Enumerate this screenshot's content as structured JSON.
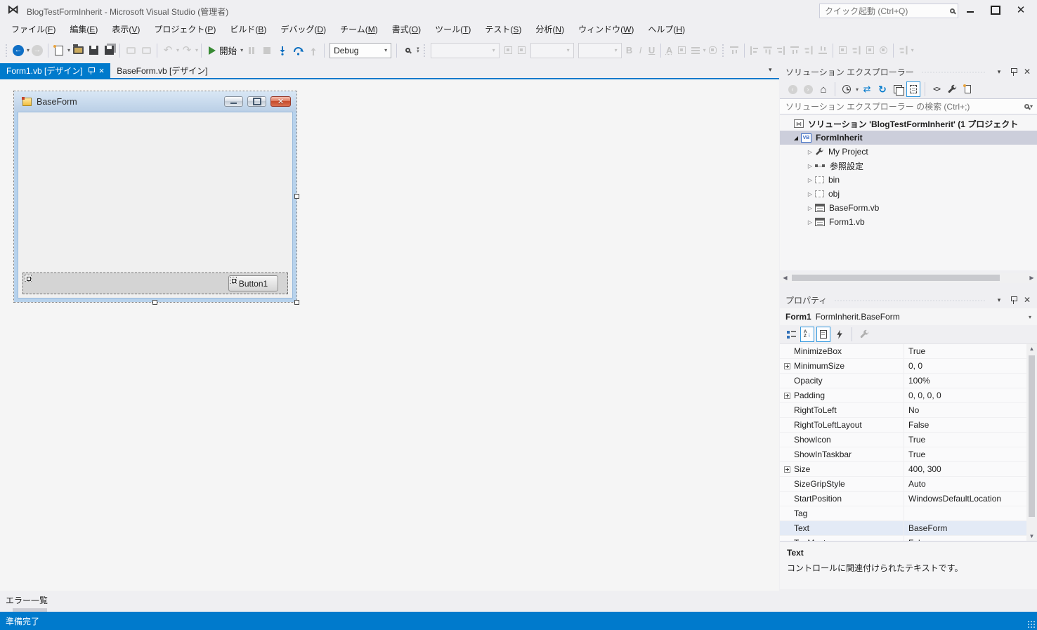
{
  "title_bar": {
    "app_title": "BlogTestFormInherit - Microsoft Visual Studio (管理者)",
    "quick_launch_placeholder": "クイック起動 (Ctrl+Q)"
  },
  "menu_bar": {
    "items": [
      {
        "label": "ファイル(F)"
      },
      {
        "label": "編集(E)"
      },
      {
        "label": "表示(V)"
      },
      {
        "label": "プロジェクト(P)"
      },
      {
        "label": "ビルド(B)"
      },
      {
        "label": "デバッグ(D)"
      },
      {
        "label": "チーム(M)"
      },
      {
        "label": "書式(O)"
      },
      {
        "label": "ツール(T)"
      },
      {
        "label": "テスト(S)"
      },
      {
        "label": "分析(N)"
      },
      {
        "label": "ウィンドウ(W)"
      },
      {
        "label": "ヘルプ(H)"
      }
    ]
  },
  "toolbar": {
    "start_label": "開始",
    "debug_combo_value": "Debug",
    "bold_label": "B",
    "italic_label": "I",
    "underline_label": "U"
  },
  "editor": {
    "tabs": [
      {
        "label": "Form1.vb [デザイン]",
        "active": true
      },
      {
        "label": "BaseForm.vb [デザイン]",
        "active": false
      }
    ]
  },
  "designer": {
    "form_title": "BaseForm",
    "button_label": "Button1"
  },
  "solution_explorer": {
    "title": "ソリューション エクスプローラー",
    "search_placeholder": "ソリューション エクスプローラー の検索 (Ctrl+;)",
    "tree": [
      {
        "label": "ソリューション 'BlogTestFormInherit' (1 プロジェクト",
        "icon": "solution",
        "arrow": "none",
        "level": 0,
        "selected": false,
        "bold": true
      },
      {
        "label": "FormInherit",
        "icon": "vb-project",
        "arrow": "expanded",
        "level": 1,
        "selected": true,
        "bold": true
      },
      {
        "label": "My Project",
        "icon": "wrench",
        "arrow": "collapsed",
        "level": 2,
        "selected": false,
        "bold": false
      },
      {
        "label": "参照設定",
        "icon": "references",
        "arrow": "collapsed",
        "level": 2,
        "selected": false,
        "bold": false
      },
      {
        "label": "bin",
        "icon": "folder-dashed",
        "arrow": "collapsed",
        "level": 2,
        "selected": false,
        "bold": false
      },
      {
        "label": "obj",
        "icon": "folder-dashed",
        "arrow": "collapsed",
        "level": 2,
        "selected": false,
        "bold": false
      },
      {
        "label": "BaseForm.vb",
        "icon": "form-file",
        "arrow": "collapsed",
        "level": 2,
        "selected": false,
        "bold": false
      },
      {
        "label": "Form1.vb",
        "icon": "form-file",
        "arrow": "collapsed",
        "level": 2,
        "selected": false,
        "bold": false
      }
    ]
  },
  "properties": {
    "title": "プロパティ",
    "object_name": "Form1",
    "object_type": "FormInherit.BaseForm",
    "rows": [
      {
        "name": "MinimizeBox",
        "value": "True",
        "expandable": false,
        "selected": false
      },
      {
        "name": "MinimumSize",
        "value": "0, 0",
        "expandable": true,
        "selected": false
      },
      {
        "name": "Opacity",
        "value": "100%",
        "expandable": false,
        "selected": false
      },
      {
        "name": "Padding",
        "value": "0, 0, 0, 0",
        "expandable": true,
        "selected": false
      },
      {
        "name": "RightToLeft",
        "value": "No",
        "expandable": false,
        "selected": false
      },
      {
        "name": "RightToLeftLayout",
        "value": "False",
        "expandable": false,
        "selected": false
      },
      {
        "name": "ShowIcon",
        "value": "True",
        "expandable": false,
        "selected": false
      },
      {
        "name": "ShowInTaskbar",
        "value": "True",
        "expandable": false,
        "selected": false
      },
      {
        "name": "Size",
        "value": "400, 300",
        "expandable": true,
        "selected": false
      },
      {
        "name": "SizeGripStyle",
        "value": "Auto",
        "expandable": false,
        "selected": false
      },
      {
        "name": "StartPosition",
        "value": "WindowsDefaultLocation",
        "expandable": false,
        "selected": false
      },
      {
        "name": "Tag",
        "value": "",
        "expandable": false,
        "selected": false
      },
      {
        "name": "Text",
        "value": "BaseForm",
        "expandable": false,
        "selected": true
      },
      {
        "name": "TopMost",
        "value": "False",
        "expandable": false,
        "selected": false
      }
    ],
    "description_title": "Text",
    "description_text": "コントロールに関連付けられたテキストです。"
  },
  "bottom": {
    "error_list_label": "エラー一覧",
    "status_text": "準備完了"
  },
  "icons": {
    "title_bar": [
      "vs-logo",
      "search",
      "minimize",
      "maximize",
      "close"
    ],
    "main_toolbar": [
      "navigate-back",
      "navigate-forward",
      "new-file",
      "open-file",
      "save",
      "save-all",
      "comment-prev",
      "comment-next",
      "undo",
      "redo",
      "start-debug",
      "pause",
      "stop",
      "step-into",
      "step-over",
      "step-out",
      "find-in-files",
      "toolbar-options",
      "bold",
      "italic",
      "underline",
      "font-color",
      "fill-color",
      "text-align",
      "unlink",
      "snap-to-grid",
      "align-lefts",
      "align-centers",
      "align-rights",
      "align-tops",
      "align-middles",
      "align-bottoms",
      "make-same-width",
      "make-same-height",
      "make-same-size",
      "lock-controls",
      "horizontal-spacing"
    ],
    "solution_explorer_toolbar": [
      "back",
      "forward",
      "home",
      "pending-changes-filter",
      "switch-views",
      "refresh",
      "collapse-all",
      "show-all-files",
      "view-code",
      "properties",
      "preview-selected-items"
    ],
    "properties_toolbar": [
      "categorized",
      "alphabetical",
      "properties",
      "events",
      "property-pages"
    ]
  },
  "colors": {
    "accent": "#007ACC",
    "status_bar": "#007ACC",
    "selection_inactive": "#CCCEDB",
    "designer_frame": "#B7D2EC"
  }
}
